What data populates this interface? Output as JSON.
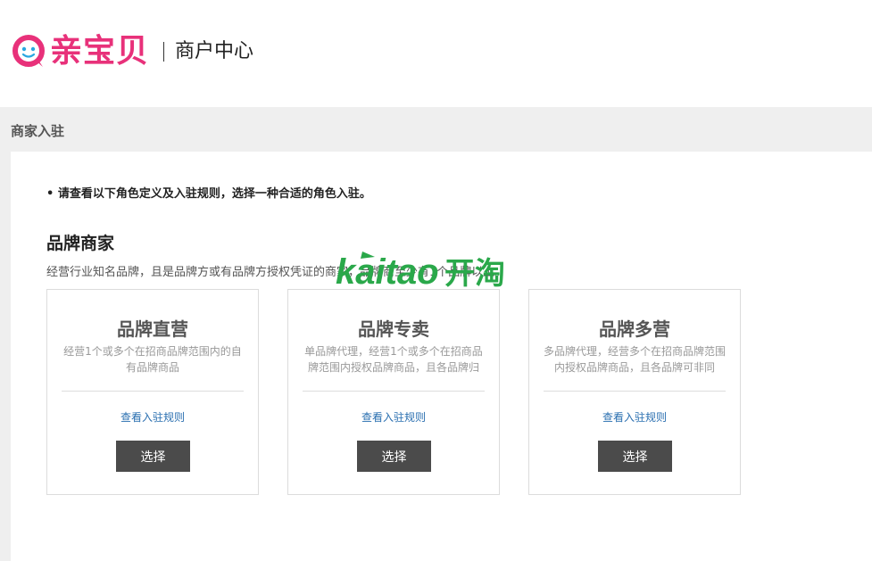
{
  "header": {
    "logo_text": "亲宝贝",
    "subtitle": "商户中心",
    "brand_color": "#e8317a"
  },
  "page_title": "商家入驻",
  "notice": "• 请查看以下角色定义及入驻规则，选择一种合适的角色入驻。",
  "section": {
    "title": "品牌商家",
    "description": "经营行业知名品牌，且是品牌方或有品牌方授权凭证的商家，品牌商至少有1个品牌以上。"
  },
  "watermark": {
    "text_en": "kaitao",
    "text_cn": "开淘",
    "color": "#2aa84a"
  },
  "cards": [
    {
      "title": "品牌直营",
      "description": "经营1个或多个在招商品牌范围内的自有品牌商品",
      "link": "查看入驻规则",
      "button": "选择"
    },
    {
      "title": "品牌专卖",
      "description": "单品牌代理，经营1个或多个在招商品牌范围内授权品牌商品，且各品牌归",
      "link": "查看入驻规则",
      "button": "选择"
    },
    {
      "title": "品牌多营",
      "description": "多品牌代理，经营多个在招商品牌范围内授权品牌商品，且各品牌可非同",
      "link": "查看入驻规则",
      "button": "选择"
    }
  ]
}
